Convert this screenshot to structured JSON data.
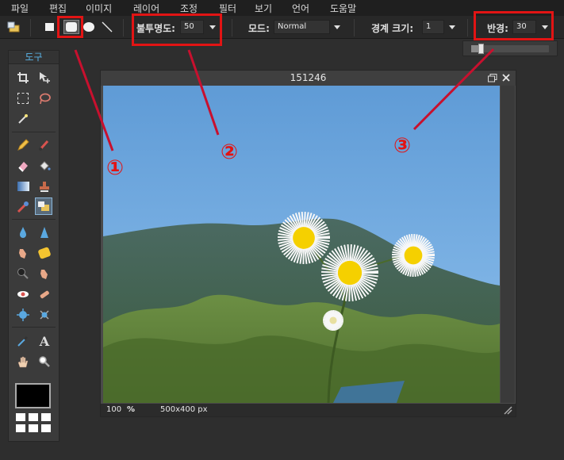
{
  "menu": [
    "파일",
    "편집",
    "이미지",
    "레이어",
    "조정",
    "필터",
    "보기",
    "언어",
    "도움말"
  ],
  "options": {
    "shapes": [
      "rectangle-icon",
      "rounded-rectangle-icon",
      "ellipse-icon",
      "line-icon"
    ],
    "opacity_label": "불투명도:",
    "opacity_value": "50",
    "mode_label": "모드:",
    "mode_value": "Normal",
    "border_label": "경계 크기:",
    "border_value": "1",
    "radius_label": "반경:",
    "radius_value": "30",
    "radius_slider_level": 0.3
  },
  "toolpanel": {
    "title": "도구"
  },
  "image_window": {
    "title": "151246",
    "zoom": "100",
    "zoom_unit": "%",
    "dimensions": "500x400 px"
  },
  "annotations": [
    "①",
    "②",
    "③"
  ],
  "colors": {
    "highlight": "#e21414",
    "panel_title": "#5ab3e6"
  }
}
